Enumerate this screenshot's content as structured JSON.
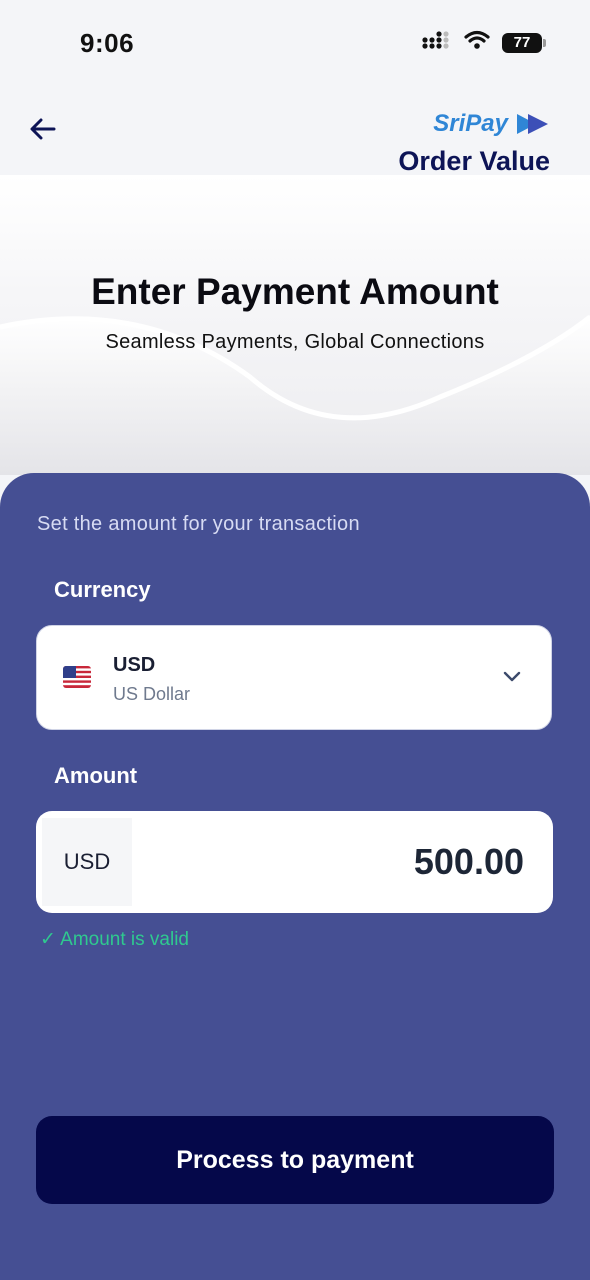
{
  "status_bar": {
    "time": "9:06",
    "battery": "77"
  },
  "header": {
    "brand": "SriPay",
    "title": "Order Value"
  },
  "hero": {
    "title": "Enter Payment Amount",
    "subtitle": "Seamless Payments, Global Connections"
  },
  "form": {
    "note": "Set the amount for your transaction",
    "currency_label": "Currency",
    "currency": {
      "code": "USD",
      "name": "US Dollar",
      "flag": "us-flag-icon"
    },
    "amount_label": "Amount",
    "amount_prefix": "USD",
    "amount_value": "500.00",
    "validation": "✓ Amount is valid"
  },
  "actions": {
    "submit_label": "Process to payment"
  },
  "colors": {
    "panel": "#454f93",
    "button": "#05084a",
    "valid": "#2fc98f",
    "brand": "#2f86d6",
    "title": "#0d1456"
  }
}
